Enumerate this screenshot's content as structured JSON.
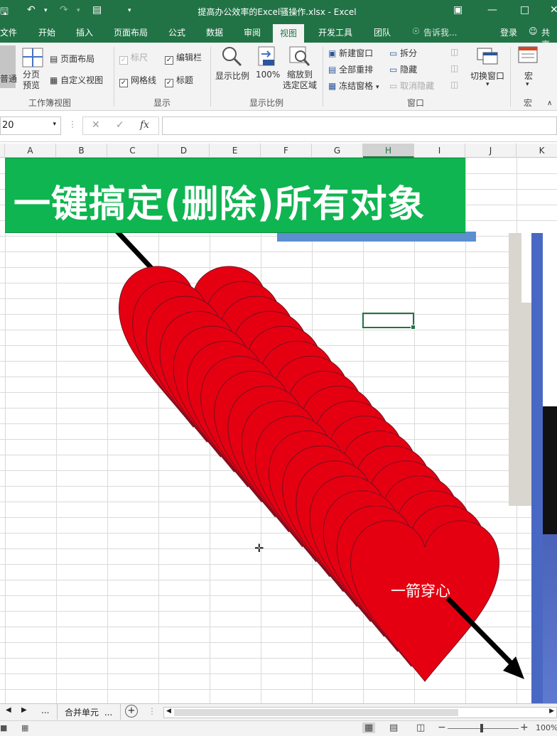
{
  "titlebar": {
    "title": "提高办公效率的Excel骚操作.xlsx - Excel"
  },
  "tabs": [
    {
      "label": "文件"
    },
    {
      "label": "开始"
    },
    {
      "label": "插入"
    },
    {
      "label": "页面布局"
    },
    {
      "label": "公式"
    },
    {
      "label": "数据"
    },
    {
      "label": "审阅"
    },
    {
      "label": "视图"
    },
    {
      "label": "开发工具"
    },
    {
      "label": "团队"
    }
  ],
  "tellme": "告诉我...",
  "account": {
    "login": "登录",
    "share": "共享"
  },
  "ribbon": {
    "normal": "普通",
    "pagebreak": "分页\n预览",
    "pagelayout": "页面布局",
    "customview": "自定义视图",
    "group_views": "工作簿视图",
    "ruler": "标尺",
    "editbar": "编辑栏",
    "gridlines": "网格线",
    "headings": "标题",
    "group_show": "显示",
    "zoom": "显示比例",
    "zoom100": "100%",
    "zoomsel": "缩放到\n选定区域",
    "group_zoom": "显示比例",
    "newwin": "新建窗口",
    "arrange": "全部重排",
    "freeze": "冻结窗格",
    "split": "拆分",
    "hide": "隐藏",
    "unhide": "取消隐藏",
    "switchwin": "切换窗口",
    "group_window": "窗口",
    "macro": "宏",
    "group_macro": "宏"
  },
  "formula": {
    "namebox": "20",
    "fx": "fx",
    "value": ""
  },
  "columns": [
    "A",
    "B",
    "C",
    "D",
    "E",
    "F",
    "G",
    "H",
    "I",
    "J",
    "K"
  ],
  "selected_column": "H",
  "banner": {
    "text": "一键搞定(删除)所有对象"
  },
  "shape_label": "一箭穿心",
  "sheet": {
    "tab": "合并单元",
    "dots": "...",
    "more": "..."
  },
  "status": {
    "zoom": "100%"
  },
  "colors": {
    "excel_green": "#217346",
    "banner_green": "#0fb550",
    "heart_red": "#e50011"
  }
}
